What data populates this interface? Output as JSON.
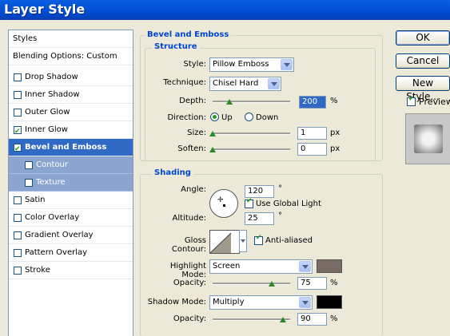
{
  "window": {
    "title": "Layer Style"
  },
  "left_list": {
    "header": "Styles",
    "blending": "Blending Options: Custom",
    "items": [
      {
        "label": "Drop Shadow",
        "checked": false
      },
      {
        "label": "Inner Shadow",
        "checked": false
      },
      {
        "label": "Outer Glow",
        "checked": false
      },
      {
        "label": "Inner Glow",
        "checked": true
      },
      {
        "label": "Bevel and Emboss",
        "checked": true,
        "selected": true
      },
      {
        "label": "Contour",
        "checked": false,
        "sub": true
      },
      {
        "label": "Texture",
        "checked": false,
        "sub": true
      },
      {
        "label": "Satin",
        "checked": false
      },
      {
        "label": "Color Overlay",
        "checked": false
      },
      {
        "label": "Gradient Overlay",
        "checked": false
      },
      {
        "label": "Pattern Overlay",
        "checked": false
      },
      {
        "label": "Stroke",
        "checked": false
      }
    ]
  },
  "bevel": {
    "section_title": "Bevel and Emboss",
    "structure_title": "Structure",
    "style_label": "Style:",
    "style_value": "Pillow Emboss",
    "technique_label": "Technique:",
    "technique_value": "Chisel Hard",
    "depth_label": "Depth:",
    "depth_value": "200",
    "depth_unit": "%",
    "direction_label": "Direction:",
    "direction_up": "Up",
    "direction_down": "Down",
    "size_label": "Size:",
    "size_value": "1",
    "size_unit": "px",
    "soften_label": "Soften:",
    "soften_value": "0",
    "soften_unit": "px"
  },
  "shading": {
    "title": "Shading",
    "angle_label": "Angle:",
    "angle_value": "120",
    "angle_unit": "°",
    "global_light_label": "Use Global Light",
    "altitude_label": "Altitude:",
    "altitude_value": "25",
    "altitude_unit": "°",
    "gloss_label": "Gloss Contour:",
    "antialiased_label": "Anti-aliased",
    "highlight_label": "Highlight Mode:",
    "highlight_value": "Screen",
    "highlight_color": "#7a6a66",
    "highlight_opacity_label": "Opacity:",
    "highlight_opacity_value": "75",
    "highlight_opacity_unit": "%",
    "shadow_label": "Shadow Mode:",
    "shadow_value": "Multiply",
    "shadow_color": "#000000",
    "shadow_opacity_label": "Opacity:",
    "shadow_opacity_value": "90",
    "shadow_opacity_unit": "%"
  },
  "buttons": {
    "ok": "OK",
    "cancel": "Cancel",
    "new_style": "New Style...",
    "preview": "Preview"
  }
}
